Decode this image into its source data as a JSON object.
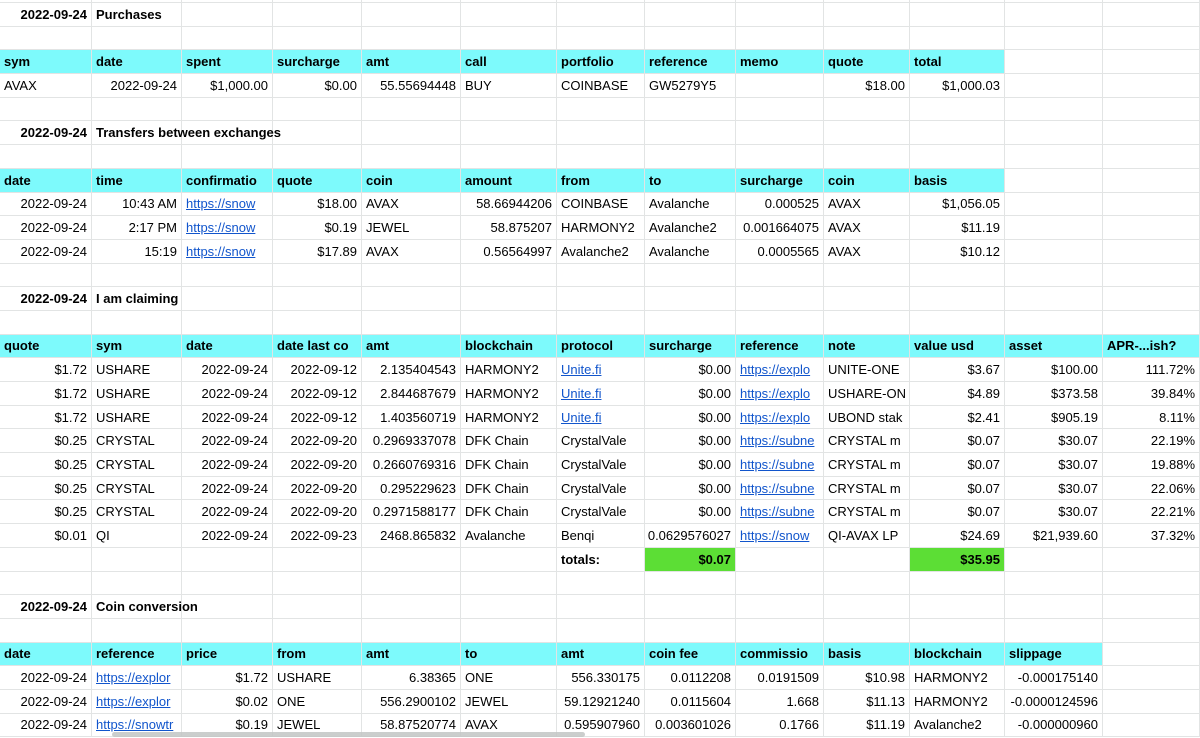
{
  "styles": {
    "header_bg": "#7dfafc",
    "total_bg": "#5cde35",
    "grid_color": "#e2e4e4",
    "link_color": "#1155cc"
  },
  "columns": {
    "widths": [
      92,
      90,
      91,
      89,
      99,
      96,
      88,
      91,
      88,
      86,
      95,
      98,
      97
    ]
  },
  "sections": [
    {
      "title_date": "2022-09-24",
      "title": "Purchases",
      "header": [
        "sym",
        "date",
        "spent",
        "surcharge",
        "amt",
        "call",
        "portfolio",
        "reference",
        "memo",
        "quote",
        "total"
      ],
      "rows": [
        [
          {
            "c": 0,
            "v": "AVAX"
          },
          {
            "c": 1,
            "v": "2022-09-24",
            "a": "r"
          },
          {
            "c": 2,
            "v": "$1,000.00",
            "a": "r"
          },
          {
            "c": 3,
            "v": "$0.00",
            "a": "r"
          },
          {
            "c": 4,
            "v": "55.55694448",
            "a": "r"
          },
          {
            "c": 5,
            "v": "BUY"
          },
          {
            "c": 6,
            "v": "COINBASE"
          },
          {
            "c": 7,
            "v": "GW5279Y5"
          },
          {
            "c": 9,
            "v": "$18.00",
            "a": "r"
          },
          {
            "c": 10,
            "v": "$1,000.03",
            "a": "r"
          }
        ]
      ]
    },
    {
      "title_date": "2022-09-24",
      "title": "Transfers between exchanges",
      "header": [
        "date",
        "time",
        "confirmatio",
        "quote",
        "coin",
        "amount",
        "from",
        "to",
        "surcharge",
        "coin",
        "basis"
      ],
      "rows": [
        [
          {
            "c": 0,
            "v": "2022-09-24",
            "a": "r"
          },
          {
            "c": 1,
            "v": "10:43 AM",
            "a": "r"
          },
          {
            "c": 2,
            "v": "https://snow",
            "link": true
          },
          {
            "c": 3,
            "v": "$18.00",
            "a": "r"
          },
          {
            "c": 4,
            "v": "AVAX"
          },
          {
            "c": 5,
            "v": "58.66944206",
            "a": "r"
          },
          {
            "c": 6,
            "v": "COINBASE"
          },
          {
            "c": 7,
            "v": "Avalanche"
          },
          {
            "c": 8,
            "v": "0.000525",
            "a": "r"
          },
          {
            "c": 9,
            "v": "AVAX"
          },
          {
            "c": 10,
            "v": "$1,056.05",
            "a": "r"
          }
        ],
        [
          {
            "c": 0,
            "v": "2022-09-24",
            "a": "r"
          },
          {
            "c": 1,
            "v": "2:17 PM",
            "a": "r"
          },
          {
            "c": 2,
            "v": "https://snow",
            "link": true
          },
          {
            "c": 3,
            "v": "$0.19",
            "a": "r"
          },
          {
            "c": 4,
            "v": "JEWEL"
          },
          {
            "c": 5,
            "v": "58.875207",
            "a": "r"
          },
          {
            "c": 6,
            "v": "HARMONY2"
          },
          {
            "c": 7,
            "v": "Avalanche2"
          },
          {
            "c": 8,
            "v": "0.001664075",
            "a": "r"
          },
          {
            "c": 9,
            "v": "AVAX"
          },
          {
            "c": 10,
            "v": "$11.19",
            "a": "r"
          }
        ],
        [
          {
            "c": 0,
            "v": "2022-09-24",
            "a": "r"
          },
          {
            "c": 1,
            "v": "15:19",
            "a": "r"
          },
          {
            "c": 2,
            "v": "https://snow",
            "link": true
          },
          {
            "c": 3,
            "v": "$17.89",
            "a": "r"
          },
          {
            "c": 4,
            "v": "AVAX"
          },
          {
            "c": 5,
            "v": "0.56564997",
            "a": "r"
          },
          {
            "c": 6,
            "v": "Avalanche2"
          },
          {
            "c": 7,
            "v": "Avalanche"
          },
          {
            "c": 8,
            "v": "0.0005565",
            "a": "r"
          },
          {
            "c": 9,
            "v": "AVAX"
          },
          {
            "c": 10,
            "v": "$10.12",
            "a": "r"
          }
        ]
      ]
    },
    {
      "title_date": "2022-09-24",
      "title": "I am claiming",
      "header": [
        "quote",
        "sym",
        "date",
        "date last co",
        "amt",
        "blockchain",
        "protocol",
        "surcharge",
        "reference",
        "note",
        "value usd",
        "asset",
        "APR-...ish?"
      ],
      "rows": [
        [
          {
            "c": 0,
            "v": "$1.72",
            "a": "r"
          },
          {
            "c": 1,
            "v": "USHARE"
          },
          {
            "c": 2,
            "v": "2022-09-24",
            "a": "r"
          },
          {
            "c": 3,
            "v": "2022-09-12",
            "a": "r"
          },
          {
            "c": 4,
            "v": "2.135404543",
            "a": "r"
          },
          {
            "c": 5,
            "v": "HARMONY2"
          },
          {
            "c": 6,
            "v": "Unite.fi",
            "link": true
          },
          {
            "c": 7,
            "v": "$0.00",
            "a": "r"
          },
          {
            "c": 8,
            "v": "https://explo",
            "link": true
          },
          {
            "c": 9,
            "v": "UNITE-ONE"
          },
          {
            "c": 10,
            "v": "$3.67",
            "a": "r"
          },
          {
            "c": 11,
            "v": "$100.00",
            "a": "r"
          },
          {
            "c": 12,
            "v": "111.72%",
            "a": "r"
          }
        ],
        [
          {
            "c": 0,
            "v": "$1.72",
            "a": "r"
          },
          {
            "c": 1,
            "v": "USHARE"
          },
          {
            "c": 2,
            "v": "2022-09-24",
            "a": "r"
          },
          {
            "c": 3,
            "v": "2022-09-12",
            "a": "r"
          },
          {
            "c": 4,
            "v": "2.844687679",
            "a": "r"
          },
          {
            "c": 5,
            "v": "HARMONY2"
          },
          {
            "c": 6,
            "v": "Unite.fi",
            "link": true
          },
          {
            "c": 7,
            "v": "$0.00",
            "a": "r"
          },
          {
            "c": 8,
            "v": "https://explo",
            "link": true
          },
          {
            "c": 9,
            "v": "USHARE-ON"
          },
          {
            "c": 10,
            "v": "$4.89",
            "a": "r"
          },
          {
            "c": 11,
            "v": "$373.58",
            "a": "r"
          },
          {
            "c": 12,
            "v": "39.84%",
            "a": "r"
          }
        ],
        [
          {
            "c": 0,
            "v": "$1.72",
            "a": "r"
          },
          {
            "c": 1,
            "v": "USHARE"
          },
          {
            "c": 2,
            "v": "2022-09-24",
            "a": "r"
          },
          {
            "c": 3,
            "v": "2022-09-12",
            "a": "r"
          },
          {
            "c": 4,
            "v": "1.403560719",
            "a": "r"
          },
          {
            "c": 5,
            "v": "HARMONY2"
          },
          {
            "c": 6,
            "v": "Unite.fi",
            "link": true
          },
          {
            "c": 7,
            "v": "$0.00",
            "a": "r"
          },
          {
            "c": 8,
            "v": "https://explo",
            "link": true
          },
          {
            "c": 9,
            "v": "UBOND stak"
          },
          {
            "c": 10,
            "v": "$2.41",
            "a": "r"
          },
          {
            "c": 11,
            "v": "$905.19",
            "a": "r"
          },
          {
            "c": 12,
            "v": "8.11%",
            "a": "r"
          }
        ],
        [
          {
            "c": 0,
            "v": "$0.25",
            "a": "r"
          },
          {
            "c": 1,
            "v": "CRYSTAL"
          },
          {
            "c": 2,
            "v": "2022-09-24",
            "a": "r"
          },
          {
            "c": 3,
            "v": "2022-09-20",
            "a": "r"
          },
          {
            "c": 4,
            "v": "0.2969337078",
            "a": "r"
          },
          {
            "c": 5,
            "v": "DFK Chain"
          },
          {
            "c": 6,
            "v": "CrystalVale"
          },
          {
            "c": 7,
            "v": "$0.00",
            "a": "r"
          },
          {
            "c": 8,
            "v": "https://subne",
            "link": true
          },
          {
            "c": 9,
            "v": "CRYSTAL m"
          },
          {
            "c": 10,
            "v": "$0.07",
            "a": "r"
          },
          {
            "c": 11,
            "v": "$30.07",
            "a": "r"
          },
          {
            "c": 12,
            "v": "22.19%",
            "a": "r"
          }
        ],
        [
          {
            "c": 0,
            "v": "$0.25",
            "a": "r"
          },
          {
            "c": 1,
            "v": "CRYSTAL"
          },
          {
            "c": 2,
            "v": "2022-09-24",
            "a": "r"
          },
          {
            "c": 3,
            "v": "2022-09-20",
            "a": "r"
          },
          {
            "c": 4,
            "v": "0.2660769316",
            "a": "r"
          },
          {
            "c": 5,
            "v": "DFK Chain"
          },
          {
            "c": 6,
            "v": "CrystalVale"
          },
          {
            "c": 7,
            "v": "$0.00",
            "a": "r"
          },
          {
            "c": 8,
            "v": "https://subne",
            "link": true
          },
          {
            "c": 9,
            "v": "CRYSTAL m"
          },
          {
            "c": 10,
            "v": "$0.07",
            "a": "r"
          },
          {
            "c": 11,
            "v": "$30.07",
            "a": "r"
          },
          {
            "c": 12,
            "v": "19.88%",
            "a": "r"
          }
        ],
        [
          {
            "c": 0,
            "v": "$0.25",
            "a": "r"
          },
          {
            "c": 1,
            "v": "CRYSTAL"
          },
          {
            "c": 2,
            "v": "2022-09-24",
            "a": "r"
          },
          {
            "c": 3,
            "v": "2022-09-20",
            "a": "r"
          },
          {
            "c": 4,
            "v": "0.295229623",
            "a": "r"
          },
          {
            "c": 5,
            "v": "DFK Chain"
          },
          {
            "c": 6,
            "v": "CrystalVale"
          },
          {
            "c": 7,
            "v": "$0.00",
            "a": "r"
          },
          {
            "c": 8,
            "v": "https://subne",
            "link": true
          },
          {
            "c": 9,
            "v": "CRYSTAL m"
          },
          {
            "c": 10,
            "v": "$0.07",
            "a": "r"
          },
          {
            "c": 11,
            "v": "$30.07",
            "a": "r"
          },
          {
            "c": 12,
            "v": "22.06%",
            "a": "r"
          }
        ],
        [
          {
            "c": 0,
            "v": "$0.25",
            "a": "r"
          },
          {
            "c": 1,
            "v": "CRYSTAL"
          },
          {
            "c": 2,
            "v": "2022-09-24",
            "a": "r"
          },
          {
            "c": 3,
            "v": "2022-09-20",
            "a": "r"
          },
          {
            "c": 4,
            "v": "0.2971588177",
            "a": "r"
          },
          {
            "c": 5,
            "v": "DFK Chain"
          },
          {
            "c": 6,
            "v": "CrystalVale"
          },
          {
            "c": 7,
            "v": "$0.00",
            "a": "r"
          },
          {
            "c": 8,
            "v": "https://subne",
            "link": true
          },
          {
            "c": 9,
            "v": "CRYSTAL m"
          },
          {
            "c": 10,
            "v": "$0.07",
            "a": "r"
          },
          {
            "c": 11,
            "v": "$30.07",
            "a": "r"
          },
          {
            "c": 12,
            "v": "22.21%",
            "a": "r"
          }
        ],
        [
          {
            "c": 0,
            "v": "$0.01",
            "a": "r"
          },
          {
            "c": 1,
            "v": "QI"
          },
          {
            "c": 2,
            "v": "2022-09-24",
            "a": "r"
          },
          {
            "c": 3,
            "v": "2022-09-23",
            "a": "r"
          },
          {
            "c": 4,
            "v": "2468.865832",
            "a": "r"
          },
          {
            "c": 5,
            "v": "Avalanche"
          },
          {
            "c": 6,
            "v": "Benqi"
          },
          {
            "c": 7,
            "v": "0.0629576027",
            "a": "r"
          },
          {
            "c": 8,
            "v": "https://snow",
            "link": true
          },
          {
            "c": 9,
            "v": "QI-AVAX LP"
          },
          {
            "c": 10,
            "v": "$24.69",
            "a": "r"
          },
          {
            "c": 11,
            "v": "$21,939.60",
            "a": "r"
          },
          {
            "c": 12,
            "v": "37.32%",
            "a": "r"
          }
        ],
        [
          {
            "c": 6,
            "v": "totals:",
            "b": true
          },
          {
            "c": 7,
            "v": "$0.07",
            "a": "r",
            "b": true,
            "bg": "total"
          },
          {
            "c": 10,
            "v": "$35.95",
            "a": "r",
            "b": true,
            "bg": "total"
          }
        ]
      ]
    },
    {
      "title_date": "2022-09-24",
      "title": "Coin conversion",
      "header": [
        "date",
        "reference",
        "price",
        "from",
        "amt",
        "to",
        "amt",
        "coin fee",
        "commissio",
        "basis",
        "blockchain",
        "slippage"
      ],
      "rows": [
        [
          {
            "c": 0,
            "v": "2022-09-24",
            "a": "r"
          },
          {
            "c": 1,
            "v": "https://explor",
            "link": true
          },
          {
            "c": 2,
            "v": "$1.72",
            "a": "r"
          },
          {
            "c": 3,
            "v": "USHARE"
          },
          {
            "c": 4,
            "v": "6.38365",
            "a": "r"
          },
          {
            "c": 5,
            "v": "ONE"
          },
          {
            "c": 6,
            "v": "556.330175",
            "a": "r"
          },
          {
            "c": 7,
            "v": "0.0112208",
            "a": "r"
          },
          {
            "c": 8,
            "v": "0.0191509",
            "a": "r"
          },
          {
            "c": 9,
            "v": "$10.98",
            "a": "r"
          },
          {
            "c": 10,
            "v": "HARMONY2"
          },
          {
            "c": 11,
            "v": "-0.000175140",
            "a": "r"
          }
        ],
        [
          {
            "c": 0,
            "v": "2022-09-24",
            "a": "r"
          },
          {
            "c": 1,
            "v": "https://explor",
            "link": true
          },
          {
            "c": 2,
            "v": "$0.02",
            "a": "r"
          },
          {
            "c": 3,
            "v": "ONE"
          },
          {
            "c": 4,
            "v": "556.2900102",
            "a": "r"
          },
          {
            "c": 5,
            "v": "JEWEL"
          },
          {
            "c": 6,
            "v": "59.12921240",
            "a": "r"
          },
          {
            "c": 7,
            "v": "0.0115604",
            "a": "r"
          },
          {
            "c": 8,
            "v": "1.668",
            "a": "r"
          },
          {
            "c": 9,
            "v": "$11.13",
            "a": "r"
          },
          {
            "c": 10,
            "v": "HARMONY2"
          },
          {
            "c": 11,
            "v": "-0.0000124596",
            "a": "r"
          }
        ],
        [
          {
            "c": 0,
            "v": "2022-09-24",
            "a": "r"
          },
          {
            "c": 1,
            "v": "https://snowtr",
            "link": true
          },
          {
            "c": 2,
            "v": "$0.19",
            "a": "r"
          },
          {
            "c": 3,
            "v": "JEWEL"
          },
          {
            "c": 4,
            "v": "58.87520774",
            "a": "r"
          },
          {
            "c": 5,
            "v": "AVAX"
          },
          {
            "c": 6,
            "v": "0.595907960",
            "a": "r"
          },
          {
            "c": 7,
            "v": "0.003601026",
            "a": "r"
          },
          {
            "c": 8,
            "v": "0.1766",
            "a": "r"
          },
          {
            "c": 9,
            "v": "$11.19",
            "a": "r"
          },
          {
            "c": 10,
            "v": "Avalanche2"
          },
          {
            "c": 11,
            "v": "-0.000000960",
            "a": "r"
          }
        ]
      ]
    }
  ]
}
